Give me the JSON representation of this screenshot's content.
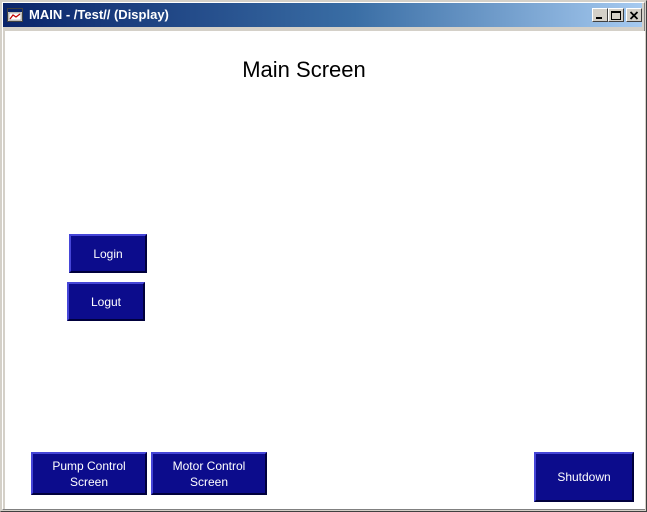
{
  "window": {
    "title": "MAIN - /Test// (Display)",
    "controls": {
      "minimize": "_",
      "maximize": "□",
      "close": "×"
    }
  },
  "main": {
    "title": "Main Screen",
    "buttons": {
      "login": "Login",
      "logout": "Logut",
      "pump_control": "Pump Control\nScreen",
      "motor_control": "Motor Control\nScreen",
      "shutdown": "Shutdown"
    }
  },
  "colors": {
    "titlebar_start": "#0a246a",
    "titlebar_end": "#a6caf0",
    "button_face": "#0c0c8c",
    "client_bg": "#ffffff"
  },
  "icons": {
    "app": "app-window-icon",
    "minimize": "minimize-icon",
    "maximize": "maximize-icon",
    "close": "close-icon"
  }
}
